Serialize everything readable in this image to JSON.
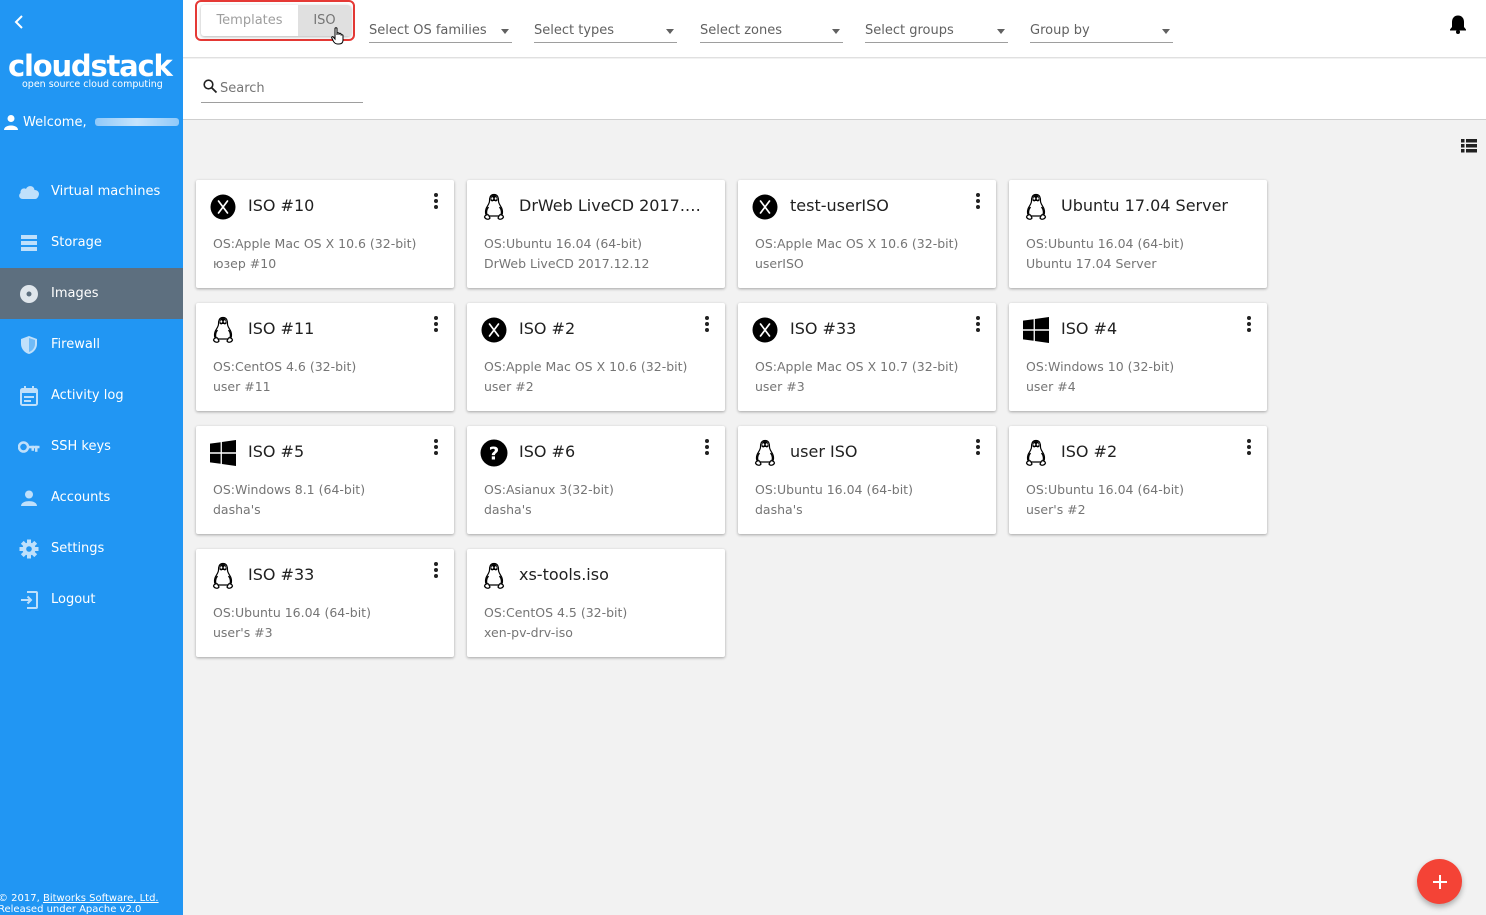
{
  "sidebar": {
    "logo_main": "cloudstack",
    "logo_sub": "open source cloud computing",
    "welcome_label": "Welcome,",
    "items": [
      {
        "label": "Virtual machines",
        "icon": "cloud-icon"
      },
      {
        "label": "Storage",
        "icon": "storage-icon"
      },
      {
        "label": "Images",
        "icon": "disc-icon",
        "active": true
      },
      {
        "label": "Firewall",
        "icon": "shield-icon"
      },
      {
        "label": "Activity log",
        "icon": "calendar-icon"
      },
      {
        "label": "SSH keys",
        "icon": "key-icon"
      },
      {
        "label": "Accounts",
        "icon": "person-icon"
      },
      {
        "label": "Settings",
        "icon": "gear-icon"
      },
      {
        "label": "Logout",
        "icon": "logout-icon"
      }
    ],
    "footer_prefix": "© 2017,",
    "footer_link": "Bitworks Software, Ltd.",
    "footer_line2": "Released under Apache v2.0"
  },
  "toolbar": {
    "tab_templates": "Templates",
    "tab_iso": "ISO",
    "selected_tab": "ISO",
    "filters": [
      "Select OS families",
      "Select types",
      "Select zones",
      "Select groups",
      "Group by"
    ]
  },
  "search": {
    "placeholder": "Search",
    "value": ""
  },
  "colors": {
    "sidebar": "#2196f3",
    "active_nav": "#5d6f7f",
    "fab": "#f44336",
    "highlight": "#e53935"
  },
  "cards": [
    {
      "title": "ISO #10",
      "os": "OS:Apple Mac OS X 10.6 (32-bit)",
      "desc": "юзер #10",
      "icon": "apple-x-icon",
      "menu": true
    },
    {
      "title": "DrWeb LiveCD 2017.1...",
      "os": "OS:Ubuntu 16.04 (64-bit)",
      "desc": "DrWeb LiveCD 2017.12.12",
      "icon": "linux-penguin-icon",
      "menu": false
    },
    {
      "title": "test-userISO",
      "os": "OS:Apple Mac OS X 10.6 (32-bit)",
      "desc": "userISO",
      "icon": "apple-x-icon",
      "menu": true
    },
    {
      "title": "Ubuntu 17.04 Server",
      "os": "OS:Ubuntu 16.04 (64-bit)",
      "desc": "Ubuntu 17.04 Server",
      "icon": "linux-penguin-icon",
      "menu": false
    },
    {
      "title": "ISO  #11",
      "os": "OS:CentOS 4.6 (32-bit)",
      "desc": "user #11",
      "icon": "linux-penguin-icon",
      "menu": true
    },
    {
      "title": "ISO #2",
      "os": "OS:Apple Mac OS X 10.6 (32-bit)",
      "desc": "user #2",
      "icon": "apple-x-icon",
      "menu": true
    },
    {
      "title": "ISO #33",
      "os": "OS:Apple Mac OS X 10.7 (32-bit)",
      "desc": "user #3",
      "icon": "apple-x-icon",
      "menu": true
    },
    {
      "title": "ISO #4",
      "os": "OS:Windows 10 (32-bit)",
      "desc": "user #4",
      "icon": "windows-icon",
      "menu": true
    },
    {
      "title": "ISO #5",
      "os": "OS:Windows 8.1 (64-bit)",
      "desc": "dasha's",
      "icon": "windows-icon",
      "menu": true
    },
    {
      "title": "ISO #6",
      "os": "OS:Asianux 3(32-bit)",
      "desc": "dasha's",
      "icon": "unknown-os-icon",
      "menu": true
    },
    {
      "title": "user ISO",
      "os": "OS:Ubuntu 16.04 (64-bit)",
      "desc": "dasha's",
      "icon": "linux-penguin-icon",
      "menu": true
    },
    {
      "title": "ISO #2",
      "os": "OS:Ubuntu 16.04 (64-bit)",
      "desc": "user's #2",
      "icon": "linux-penguin-icon",
      "menu": true
    },
    {
      "title": "ISO #33",
      "os": "OS:Ubuntu 16.04 (64-bit)",
      "desc": "user's #3",
      "icon": "linux-penguin-icon",
      "menu": true
    },
    {
      "title": "xs-tools.iso",
      "os": "OS:CentOS 4.5 (32-bit)",
      "desc": "xen-pv-drv-iso",
      "icon": "linux-penguin-icon",
      "menu": false
    }
  ],
  "fab": {
    "label": "+",
    "icon": "plus-icon"
  }
}
